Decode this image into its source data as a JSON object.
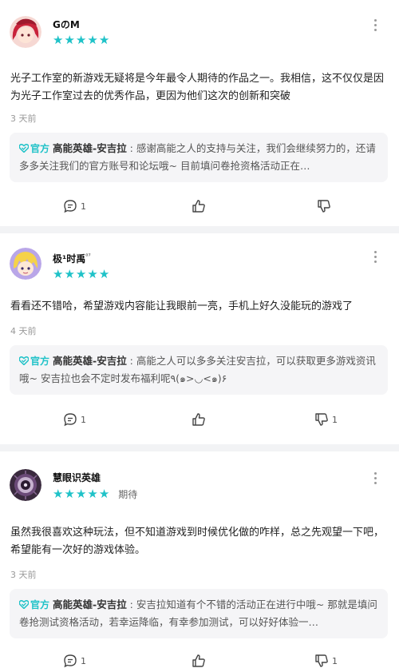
{
  "reviews": [
    {
      "username": "GのM",
      "username_sup": "",
      "status": "",
      "content": "光子工作室的新游戏无疑将是今年最令人期待的作品之一。我相信，这不仅仅是因为光子工作室过去的优秀作品，更因为他们这次的创新和突破",
      "time": "3 天前",
      "reply": {
        "official": "官方",
        "replier": "高能英雄-安吉拉",
        "text": "感谢高能之人的支持与关注，我们会继续努力的，还请多多关注我们的官方账号和论坛哦~ 目前填问卷抢资格活动正在…"
      },
      "comments": "1",
      "likes": "",
      "dislikes": ""
    },
    {
      "username": "极¹时禹",
      "username_sup": "⁰⁷",
      "status": "",
      "content": "看看还不错哈，希望游戏内容能让我眼前一亮，手机上好久没能玩的游戏了",
      "time": "4 天前",
      "reply": {
        "official": "官方",
        "replier": "高能英雄-安吉拉",
        "text": "高能之人可以多多关注安吉拉，可以获取更多游戏资讯哦~ 安吉拉也会不定时发布福利呢٩(๑>◡<๑)۶"
      },
      "comments": "1",
      "likes": "",
      "dislikes": "1"
    },
    {
      "username": "慧眼识英雄",
      "username_sup": "",
      "status": "期待",
      "content": "虽然我很喜欢这种玩法，但不知道游戏到时候优化做的咋样，总之先观望一下吧，希望能有一次好的游戏体验。",
      "time": "3 天前",
      "reply": {
        "official": "官方",
        "replier": "高能英雄-安吉拉",
        "text": "安吉拉知道有个不错的活动正在进行中哦~ 那就是填问卷抢测试资格活动，若幸运降临，有幸参加测试，可以好好体验一…"
      },
      "comments": "1",
      "likes": "",
      "dislikes": "1"
    }
  ],
  "colors": {
    "accent": "#1fc2c8",
    "background": "#f2f3f5",
    "reply_bg": "#f5f5f7"
  },
  "icons": [
    "more-icon",
    "star-icon",
    "heart-icon",
    "comment-icon",
    "thumbs-up-icon",
    "thumbs-down-icon"
  ]
}
